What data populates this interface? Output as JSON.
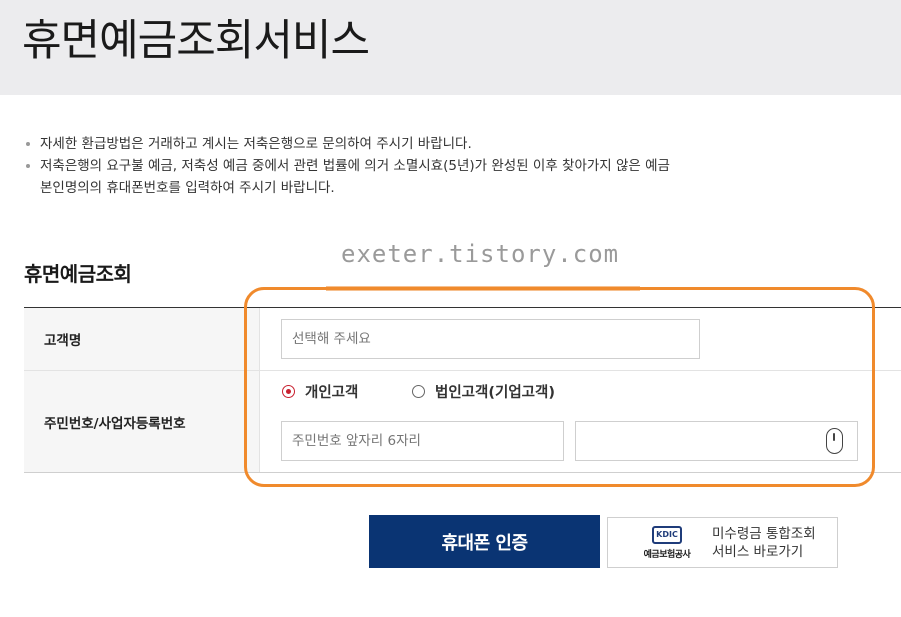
{
  "header": {
    "title": "휴면예금조회서비스"
  },
  "notices": [
    {
      "lines": [
        "자세한 환급방법은 거래하고 계시는 저축은행으로 문의하여 주시기 바랍니다."
      ]
    },
    {
      "lines": [
        "저축은행의 요구불 예금, 저축성 예금 중에서 관련 법률에 의거 소멸시효(5년)가 완성된 이후 찾아가지 않은 예금",
        "본인명의의 휴대폰번호를 입력하여 주시기 바랍니다."
      ]
    }
  ],
  "watermark": "exeter.tistory.com",
  "form": {
    "section_title": "휴면예금조회",
    "name_row": {
      "label": "고객명",
      "placeholder": "선택해 주세요"
    },
    "id_row": {
      "label": "주민번호/사업자등록번호",
      "options": [
        {
          "label": "개인고객",
          "checked": true
        },
        {
          "label": "법인고객(기업고객)",
          "checked": false
        }
      ],
      "front_placeholder": "주민번호 앞자리 6자리",
      "back_value": ""
    }
  },
  "buttons": {
    "phone_auth": "휴대폰 인증",
    "kdic": {
      "logo_mark": "KDIC",
      "logo_name": "예금보험공사",
      "line1": "미수령금 통합조회",
      "line2": "서비스 바로가기"
    }
  },
  "colors": {
    "primary": "#0a3473",
    "highlight": "#f08a2c",
    "radio_checked": "#c8202f"
  },
  "icons": {
    "secure_input": "mouse-icon"
  }
}
